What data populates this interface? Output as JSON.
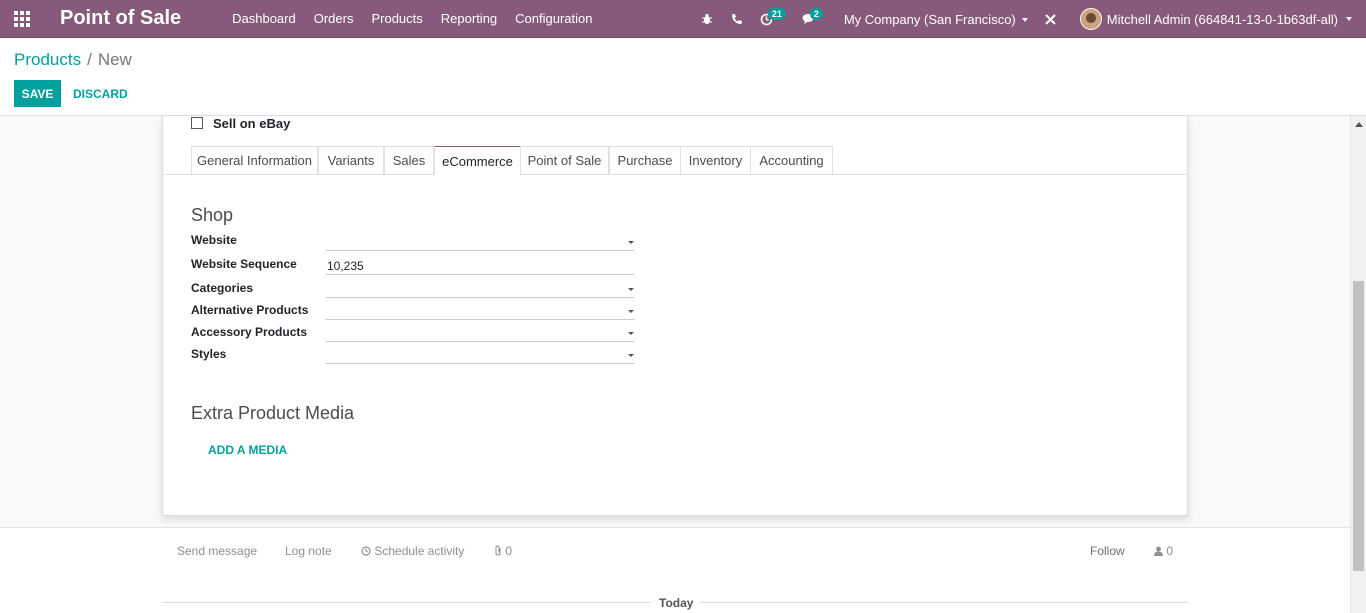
{
  "navbar": {
    "app_title": "Point of Sale",
    "menu": [
      "Dashboard",
      "Orders",
      "Products",
      "Reporting",
      "Configuration"
    ],
    "activity_badge": "21",
    "messages_badge": "2",
    "company": "My Company (San Francisco)",
    "user": "Mitchell Admin (664841-13-0-1b63df-all)",
    "icons": [
      "apps-grid-icon",
      "bug-icon",
      "phone-icon",
      "clock-icon",
      "chat-icon",
      "close-icon"
    ]
  },
  "breadcrumb": {
    "parent": "Products",
    "separator": "/",
    "current": "New"
  },
  "buttons": {
    "save": "SAVE",
    "discard": "DISCARD"
  },
  "form": {
    "sell_on_ebay_label": "Sell on eBay",
    "tabs": [
      "General Information",
      "Variants",
      "Sales",
      "eCommerce",
      "Point of Sale",
      "Purchase",
      "Inventory",
      "Accounting"
    ],
    "active_tab": "eCommerce",
    "shop_title": "Shop",
    "fields": [
      {
        "label": "Website",
        "value": ""
      },
      {
        "label": "Website Sequence",
        "value": "10,235"
      },
      {
        "label": "Categories",
        "value": ""
      },
      {
        "label": "Alternative Products",
        "value": ""
      },
      {
        "label": "Accessory Products",
        "value": ""
      },
      {
        "label": "Styles",
        "value": ""
      }
    ],
    "media_title": "Extra Product Media",
    "add_media": "ADD A MEDIA"
  },
  "chatter": {
    "send_message": "Send message",
    "log_note": "Log note",
    "schedule_activity": "Schedule activity",
    "attachments": "0",
    "follow": "Follow",
    "followers": "0",
    "today": "Today"
  },
  "colors": {
    "brand": "#875a7b",
    "accent": "#00a09d"
  }
}
